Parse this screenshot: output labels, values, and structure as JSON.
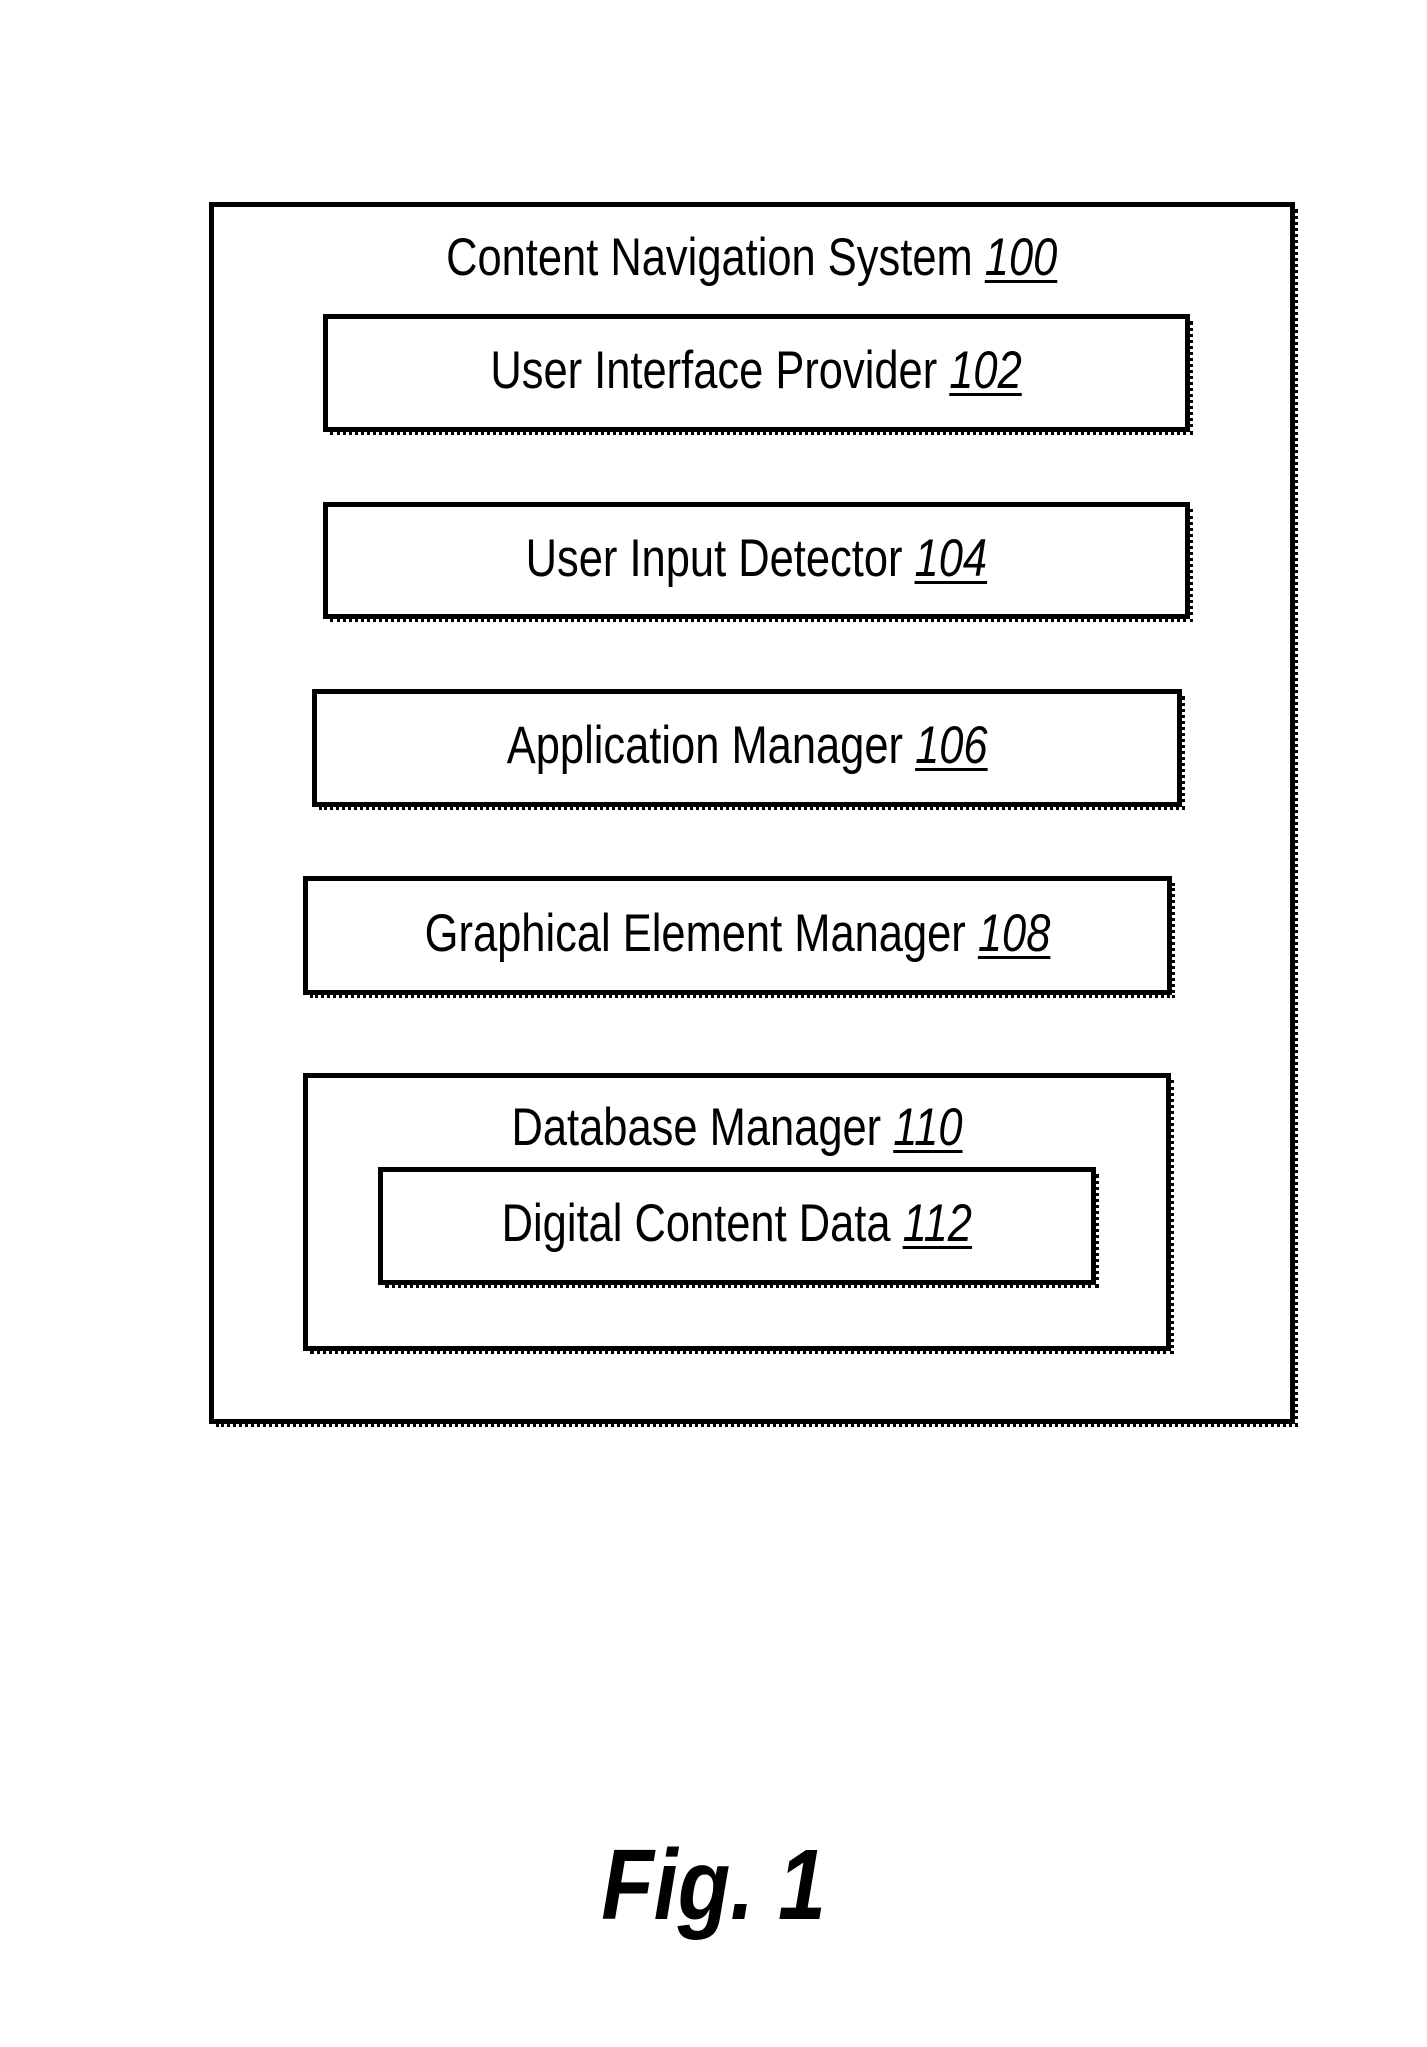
{
  "diagram": {
    "system": {
      "name": "Content Navigation System",
      "ref": "100"
    },
    "components": [
      {
        "name": "User Interface Provider",
        "ref": "102"
      },
      {
        "name": "User Input Detector",
        "ref": "104"
      },
      {
        "name": "Application Manager",
        "ref": "106"
      },
      {
        "name": "Graphical Element Manager",
        "ref": "108"
      },
      {
        "name": "Database Manager",
        "ref": "110",
        "children": [
          {
            "name": "Digital Content Data",
            "ref": "112"
          }
        ]
      }
    ]
  },
  "figure_label": "Fig. 1"
}
